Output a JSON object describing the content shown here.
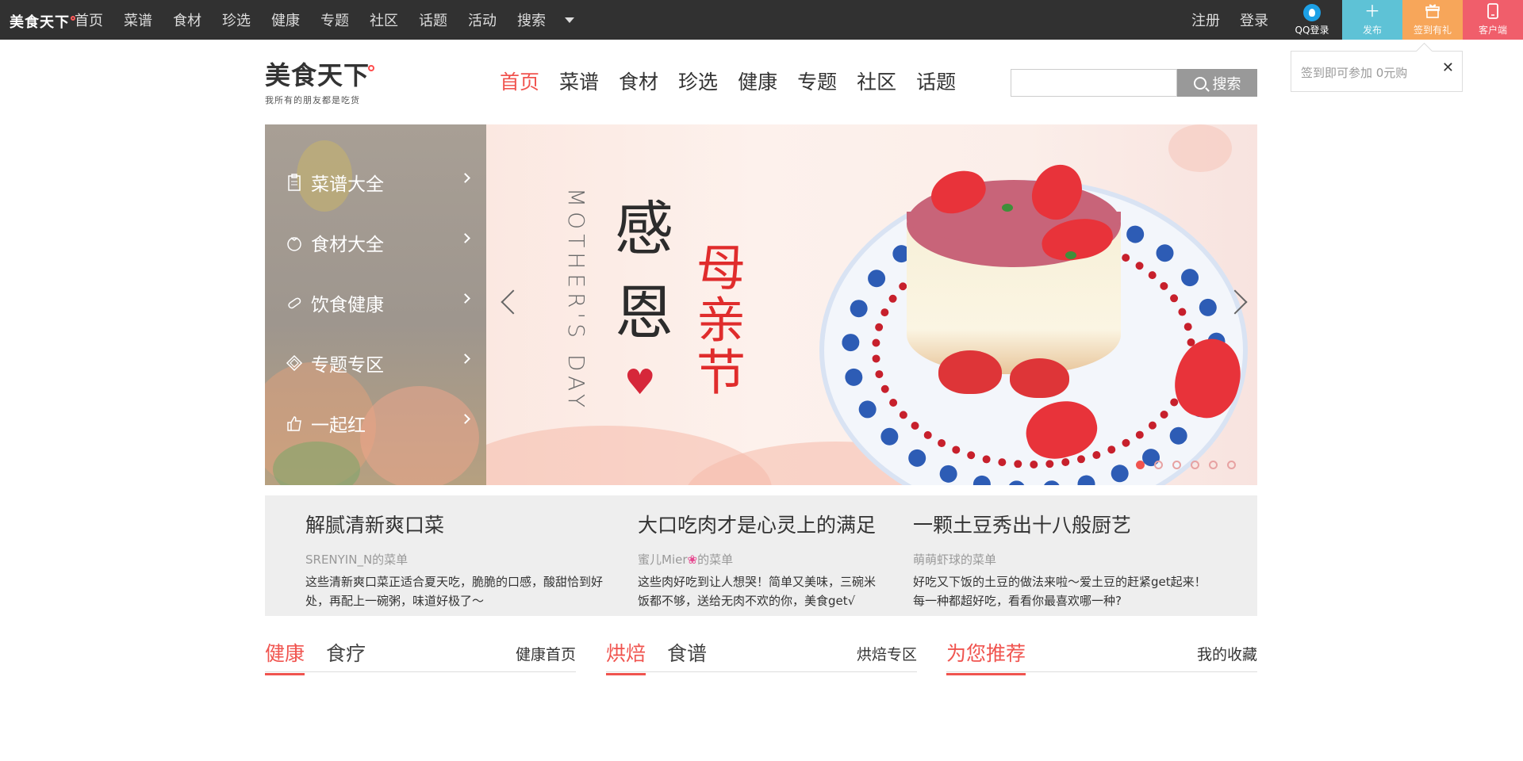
{
  "topbar": {
    "logo": "美食天下",
    "nav": [
      "首页",
      "菜谱",
      "食材",
      "珍选",
      "健康",
      "专题",
      "社区",
      "话题",
      "活动",
      "搜索"
    ],
    "register": "注册",
    "login": "登录",
    "qq_login": "QQ登录",
    "tiles": {
      "publish": "发布",
      "signin": "签到有礼",
      "client": "客户端"
    }
  },
  "popup": {
    "text": "签到即可参加 0元购",
    "close": "✕"
  },
  "header": {
    "brand": "美食天下",
    "slogan": "我所有的朋友都是吃货",
    "nav": [
      "首页",
      "菜谱",
      "食材",
      "珍选",
      "健康",
      "专题",
      "社区",
      "话题"
    ],
    "active_nav": "首页",
    "search_placeholder": "",
    "search_button": "搜索"
  },
  "sidemenu": [
    "菜谱大全",
    "食材大全",
    "饮食健康",
    "专题专区",
    "一起红"
  ],
  "banner": {
    "english": "MOTHER'S DAY",
    "line1": "感",
    "line2": "恩",
    "red": "母亲节",
    "dots_total": 6,
    "dots_active": 0
  },
  "featured": [
    {
      "title": "解腻清新爽口菜",
      "author": "SRENYIN_N的菜单",
      "desc": "这些清新爽口菜正适合夏天吃，脆脆的口感，酸甜恰到好处，再配上一碗粥，味道好极了～"
    },
    {
      "title": "大口吃肉才是心灵上的满足",
      "author_pre": "蜜儿Mier",
      "author_post": "的菜单",
      "desc": "这些肉好吃到让人想哭！简单又美味，三碗米饭都不够，送给无肉不欢的你，美食get√"
    },
    {
      "title": "一颗土豆秀出十八般厨艺",
      "author": "萌萌虾球的菜单",
      "desc": "好吃又下饭的土豆的做法来啦～爱土豆的赶紧get起来！每一种都超好吃，看看你最喜欢哪一种?"
    }
  ],
  "sections": [
    {
      "tabs": [
        "健康",
        "食疗"
      ],
      "more": "健康首页"
    },
    {
      "tabs": [
        "烘焙",
        "食谱"
      ],
      "more": "烘焙专区"
    },
    {
      "tabs": [
        "为您推荐"
      ],
      "more": "我的收藏"
    }
  ],
  "colors": {
    "accent": "#f0544f",
    "topbar": "#313131",
    "publish": "#5ec2d6",
    "signin": "#f7a65a",
    "client": "#f05e6b"
  }
}
